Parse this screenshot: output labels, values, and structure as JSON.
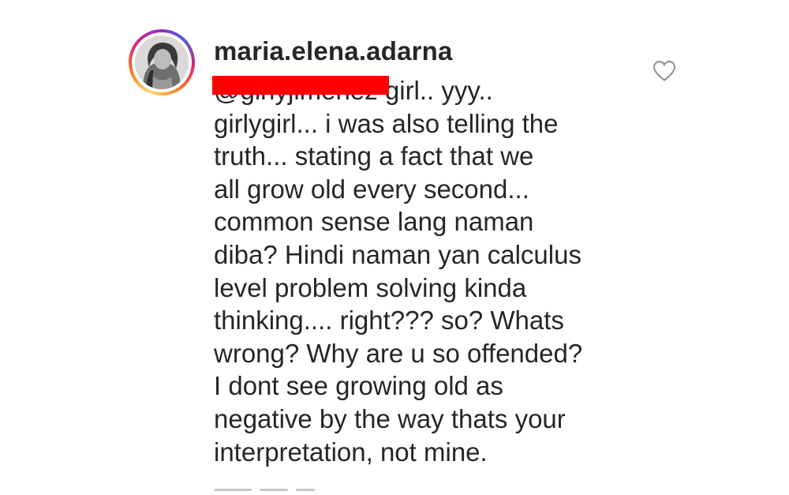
{
  "comment": {
    "username": "maria.elena.adarna",
    "mention_redacted": "@girlyjimenez",
    "lines": [
      " girl.. yyy..",
      "girlygirl... i was also telling the",
      "truth... stating a fact that we",
      "all grow old every second...",
      "common sense lang naman",
      "diba? Hindi naman yan calculus",
      "level problem solving kinda",
      "thinking.... right??? so? Whats",
      "wrong? Why are u so offended?",
      "I dont see growing old as",
      "negative by the way thats your",
      "interpretation, not mine."
    ],
    "like_icon": "heart-outline-icon",
    "redaction_color": "#ff0000"
  },
  "story_ring_colors": [
    "#feda75",
    "#fa7e1e",
    "#d62976",
    "#962fbf",
    "#4f5bd5"
  ]
}
